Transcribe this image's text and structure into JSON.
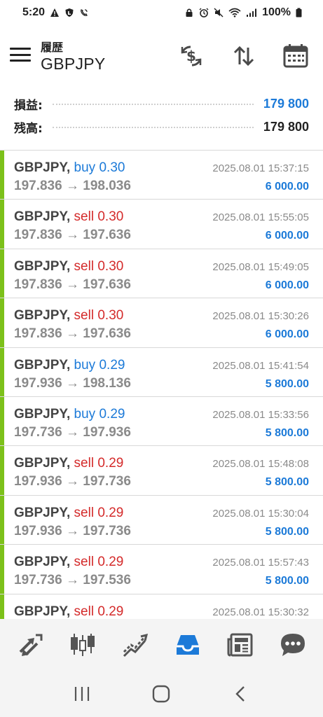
{
  "status_bar": {
    "time": "5:20",
    "battery": "100%"
  },
  "header": {
    "subtitle": "履歴",
    "title": "GBPJPY"
  },
  "summary": {
    "profit_label": "損益:",
    "profit_value": "179 800",
    "balance_label": "残高:",
    "balance_value": "179 800"
  },
  "deals": [
    {
      "symbol": "GBPJPY,",
      "type": "buy",
      "volume": "0.30",
      "price_from": "197.836",
      "arrow": "→",
      "price_to": "198.036",
      "time": "2025.08.01 15:37:15",
      "profit": "6 000.00"
    },
    {
      "symbol": "GBPJPY,",
      "type": "sell",
      "volume": "0.30",
      "price_from": "197.836",
      "arrow": "→",
      "price_to": "197.636",
      "time": "2025.08.01 15:55:05",
      "profit": "6 000.00"
    },
    {
      "symbol": "GBPJPY,",
      "type": "sell",
      "volume": "0.30",
      "price_from": "197.836",
      "arrow": "→",
      "price_to": "197.636",
      "time": "2025.08.01 15:49:05",
      "profit": "6 000.00"
    },
    {
      "symbol": "GBPJPY,",
      "type": "sell",
      "volume": "0.30",
      "price_from": "197.836",
      "arrow": "→",
      "price_to": "197.636",
      "time": "2025.08.01 15:30:26",
      "profit": "6 000.00"
    },
    {
      "symbol": "GBPJPY,",
      "type": "buy",
      "volume": "0.29",
      "price_from": "197.936",
      "arrow": "→",
      "price_to": "198.136",
      "time": "2025.08.01 15:41:54",
      "profit": "5 800.00"
    },
    {
      "symbol": "GBPJPY,",
      "type": "buy",
      "volume": "0.29",
      "price_from": "197.736",
      "arrow": "→",
      "price_to": "197.936",
      "time": "2025.08.01 15:33:56",
      "profit": "5 800.00"
    },
    {
      "symbol": "GBPJPY,",
      "type": "sell",
      "volume": "0.29",
      "price_from": "197.936",
      "arrow": "→",
      "price_to": "197.736",
      "time": "2025.08.01 15:48:08",
      "profit": "5 800.00"
    },
    {
      "symbol": "GBPJPY,",
      "type": "sell",
      "volume": "0.29",
      "price_from": "197.936",
      "arrow": "→",
      "price_to": "197.736",
      "time": "2025.08.01 15:30:04",
      "profit": "5 800.00"
    },
    {
      "symbol": "GBPJPY,",
      "type": "sell",
      "volume": "0.29",
      "price_from": "197.736",
      "arrow": "→",
      "price_to": "197.536",
      "time": "2025.08.01 15:57:43",
      "profit": "5 800.00"
    },
    {
      "symbol": "GBPJPY,",
      "type": "sell",
      "volume": "0.29",
      "price_from": "",
      "arrow": "",
      "price_to": "",
      "time": "2025.08.01 15:30:32",
      "profit": ""
    }
  ],
  "header_icons": [
    "currency-exchange-icon",
    "sort-icon",
    "calendar-icon"
  ],
  "bottom_nav": [
    {
      "name": "quotes",
      "icon": "quotes-arrows-icon",
      "active": false
    },
    {
      "name": "chart",
      "icon": "candlestick-icon",
      "active": false
    },
    {
      "name": "trade",
      "icon": "trend-icon",
      "active": false
    },
    {
      "name": "history",
      "icon": "inbox-icon",
      "active": true
    },
    {
      "name": "news",
      "icon": "newspaper-icon",
      "active": false
    },
    {
      "name": "messages",
      "icon": "chat-bubble-icon",
      "active": false
    }
  ],
  "colors": {
    "accent": "#1c7ad8",
    "sell": "#d42a2a",
    "profit_bar": "#7cc11a",
    "icon": "#555555",
    "active": "#1c7ad8"
  }
}
